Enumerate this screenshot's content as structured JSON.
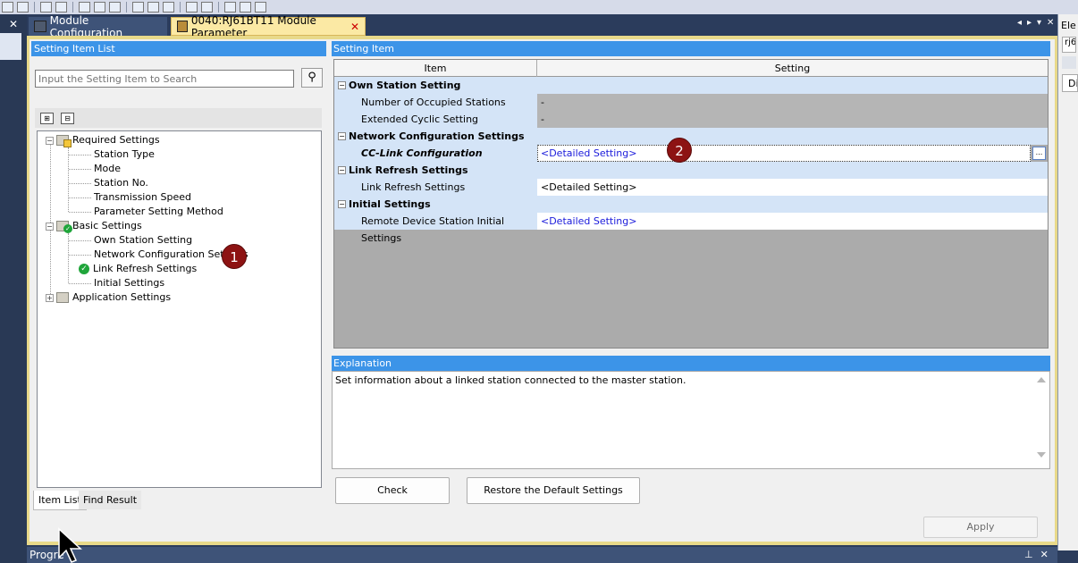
{
  "tabs": [
    {
      "label": "Module Configuration"
    },
    {
      "label": "0040:RJ61BT11 Module Parameter"
    }
  ],
  "left_pane": {
    "title": "Setting Item List",
    "search_placeholder": "Input the Setting Item to Search",
    "tree": {
      "required": {
        "label": "Required Settings",
        "children": [
          "Station Type",
          "Mode",
          "Station No.",
          "Transmission Speed",
          "Parameter Setting Method"
        ]
      },
      "basic": {
        "label": "Basic Settings",
        "children": [
          "Own Station Setting",
          "Network Configuration Settings",
          "Link Refresh Settings",
          "Initial Settings"
        ]
      },
      "application": {
        "label": "Application Settings"
      }
    },
    "bottom_tabs": [
      "Item List",
      "Find Result"
    ]
  },
  "right_pane": {
    "title": "Setting Item",
    "columns": [
      "Item",
      "Setting"
    ],
    "rows": [
      {
        "item": "Own Station Setting",
        "setting": ""
      },
      {
        "item": "Number of Occupied Stations",
        "setting": "-"
      },
      {
        "item": "Extended Cyclic Setting",
        "setting": "-"
      },
      {
        "item": "Network Configuration Settings",
        "setting": ""
      },
      {
        "item": "CC-Link Configuration",
        "setting": "<Detailed Setting>"
      },
      {
        "item": "Link Refresh Settings",
        "setting": ""
      },
      {
        "item": "Link Refresh Settings",
        "setting": "<Detailed Setting>"
      },
      {
        "item": "Initial Settings",
        "setting": ""
      },
      {
        "item": "Remote Device Station Initial Settings",
        "setting": "<Detailed Setting>"
      }
    ],
    "ellipsis": "..."
  },
  "explanation": {
    "title": "Explanation",
    "text": "Set information about a linked station connected to the master station."
  },
  "buttons": {
    "check": "Check",
    "restore": "Restore the Default Settings",
    "apply": "Apply"
  },
  "annotations": {
    "badge1": "1",
    "badge2": "2"
  },
  "dock": {
    "title": "Progre"
  },
  "right_edge": {
    "label1": "Ele",
    "label2": "rj6",
    "label3": "Di"
  }
}
